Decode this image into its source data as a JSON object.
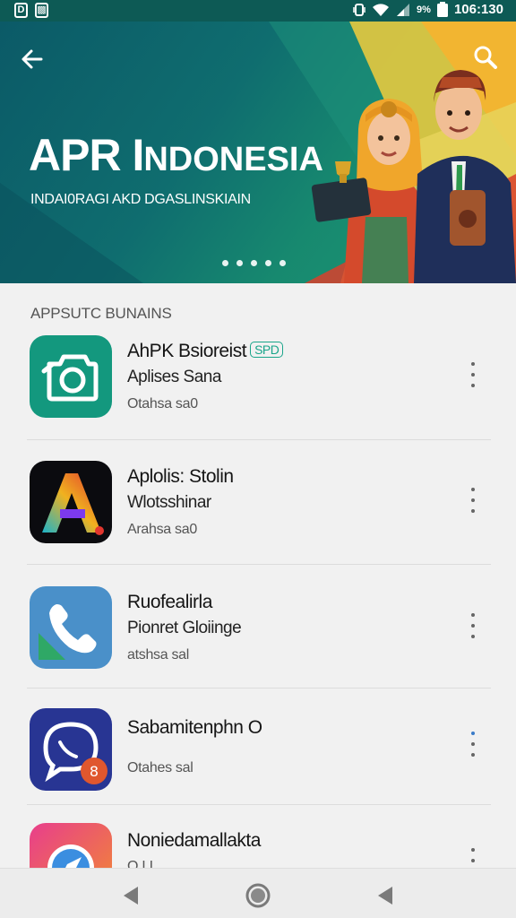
{
  "status_bar": {
    "time": "106:130",
    "battery_text": "9%"
  },
  "hero": {
    "title_main": "APR I",
    "title_rest": "NDONESIA",
    "subtitle": "INDAI0RAGI AKD DGASLINSKIAIN",
    "carousel_dots": 5
  },
  "section_title": "APPSUTC BUNAINS",
  "apps": [
    {
      "name": "AhPK Bsioreist",
      "tag": "SPD",
      "developer": "Aplises Sana",
      "meta": "Otahsa sa0"
    },
    {
      "name": "Aplolis: Stolin",
      "tag": "",
      "developer": "Wlotsshinar",
      "meta": "Arahsa sa0"
    },
    {
      "name": "Ruofealirla",
      "tag": "",
      "developer": "Pionret Gloiinge",
      "meta": "atshsa sal"
    },
    {
      "name": "Sabamitenphn O",
      "tag": "",
      "developer": "",
      "meta": "Otahes sal"
    },
    {
      "name": "Noniedamallakta",
      "tag": "",
      "developer": "",
      "meta": "O.I.I"
    }
  ],
  "colors": {
    "banner_teal": "#0f6d6f",
    "accent_green": "#1aa58a",
    "status_bar": "#0d5a55"
  },
  "icons": {
    "back": "arrow-left-icon",
    "search": "search-icon",
    "more": "more-vert-icon",
    "nav_back": "triangle-back-icon",
    "nav_home": "circle-home-icon",
    "nav_recent": "triangle-recent-icon"
  }
}
